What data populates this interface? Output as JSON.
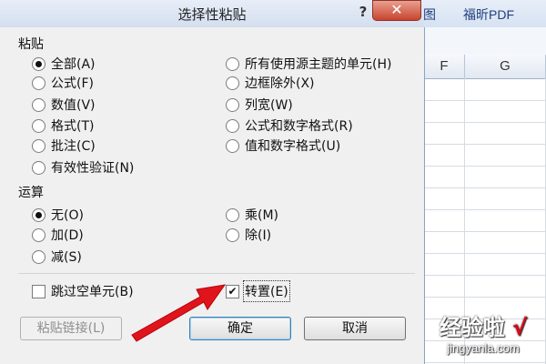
{
  "dialog": {
    "title": "选择性粘贴",
    "help_glyph": "?",
    "close_glyph": "✕"
  },
  "ribbon": {
    "tabs": [
      "图",
      "福昕PDF"
    ]
  },
  "sheet": {
    "columns": [
      "F",
      "G"
    ]
  },
  "paste_section": {
    "label": "粘贴",
    "options": [
      {
        "label": "全部(A)",
        "selected": true
      },
      {
        "label": "公式(F)",
        "selected": false
      },
      {
        "label": "数值(V)",
        "selected": false
      },
      {
        "label": "格式(T)",
        "selected": false
      },
      {
        "label": "批注(C)",
        "selected": false
      },
      {
        "label": "有效性验证(N)",
        "selected": false
      },
      {
        "label": "所有使用源主题的单元(H)",
        "selected": false
      },
      {
        "label": "边框除外(X)",
        "selected": false
      },
      {
        "label": "列宽(W)",
        "selected": false
      },
      {
        "label": "公式和数字格式(R)",
        "selected": false
      },
      {
        "label": "值和数字格式(U)",
        "selected": false
      }
    ]
  },
  "operation_section": {
    "label": "运算",
    "options": [
      {
        "label": "无(O)",
        "selected": true
      },
      {
        "label": "加(D)",
        "selected": false
      },
      {
        "label": "减(S)",
        "selected": false
      },
      {
        "label": "乘(M)",
        "selected": false
      },
      {
        "label": "除(I)",
        "selected": false
      }
    ]
  },
  "checkboxes": {
    "skip_blanks": {
      "label": "跳过空单元(B)",
      "checked": false
    },
    "transpose": {
      "label": "转置(E)",
      "checked": true
    }
  },
  "buttons": {
    "paste_link": "粘贴链接(L)",
    "ok": "确定",
    "cancel": "取消"
  },
  "watermark": {
    "text": "经验啦",
    "check": "√",
    "url": "jingyanla.com"
  },
  "colors": {
    "close_button": "#c8442d",
    "arrow": "#e0141b",
    "dialog_bg": "#f0f0f0"
  }
}
